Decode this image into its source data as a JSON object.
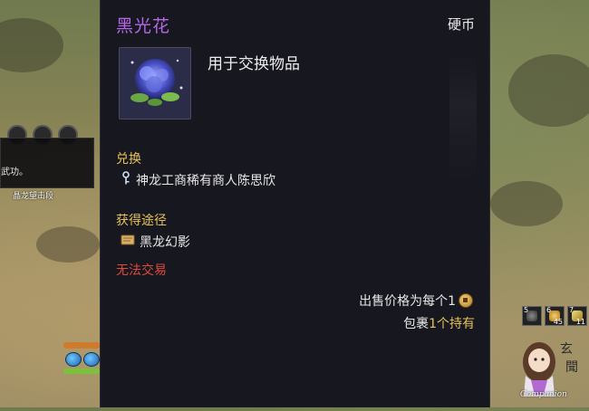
{
  "item": {
    "name": "黑光花",
    "category": "硬币",
    "description": "用于交换物品",
    "exchange_label": "兑换",
    "exchange_npc": "神龙工商稀有商人陈思欣",
    "source_label": "获得途径",
    "source_value": "黑龙幻影",
    "trade_status": "无法交易",
    "sell_price_label": "出售价格为每个1",
    "bag_prefix": "包裹",
    "bag_count": "1个持有",
    "colors": {
      "title": "#b468e8",
      "section": "#e6c35a",
      "warning": "#e0493c"
    }
  },
  "left_hud": {
    "popup_text": "武功。",
    "skill_label": "晶龙望击段"
  },
  "quick_slots": [
    {
      "num": "5",
      "count": ""
    },
    {
      "num": "6",
      "count": "45"
    },
    {
      "num": "7",
      "count": "11"
    }
  ],
  "watermark": {
    "text": "Companion"
  },
  "icons": [
    "flower-item-icon",
    "key-icon",
    "scroll-icon",
    "coin-icon"
  ]
}
